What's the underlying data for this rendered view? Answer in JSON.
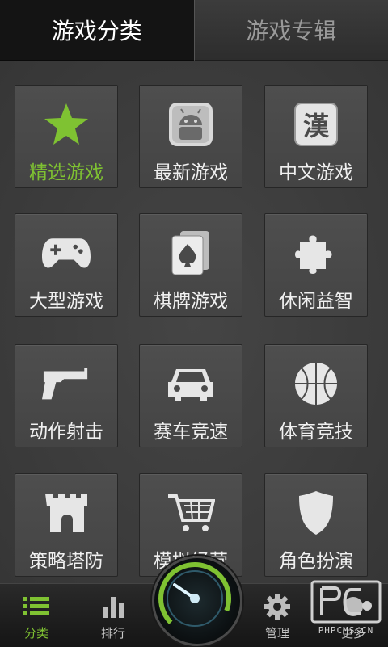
{
  "tabs": [
    {
      "label": "游戏分类",
      "active": true
    },
    {
      "label": "游戏专辑",
      "active": false
    }
  ],
  "categories": [
    {
      "label": "精选游戏",
      "icon": "star-icon",
      "selected": true
    },
    {
      "label": "最新游戏",
      "icon": "android-icon",
      "selected": false
    },
    {
      "label": "中文游戏",
      "icon": "chinese-character-icon",
      "glyph": "漢",
      "selected": false
    },
    {
      "label": "大型游戏",
      "icon": "gamepad-icon",
      "selected": false
    },
    {
      "label": "棋牌游戏",
      "icon": "playing-cards-icon",
      "selected": false
    },
    {
      "label": "休闲益智",
      "icon": "puzzle-piece-icon",
      "selected": false
    },
    {
      "label": "动作射击",
      "icon": "pistol-icon",
      "selected": false
    },
    {
      "label": "赛车竞速",
      "icon": "car-icon",
      "selected": false
    },
    {
      "label": "体育竞技",
      "icon": "basketball-icon",
      "selected": false
    },
    {
      "label": "策略塔防",
      "icon": "castle-tower-icon",
      "selected": false
    },
    {
      "label": "模拟经营",
      "icon": "shopping-cart-icon",
      "selected": false
    },
    {
      "label": "角色扮演",
      "icon": "shield-icon",
      "selected": false
    }
  ],
  "bottom_nav": [
    {
      "label": "分类",
      "icon": "list-icon",
      "active": true
    },
    {
      "label": "排行",
      "icon": "bar-chart-icon",
      "active": false
    },
    {
      "label": "",
      "icon": "speedometer-icon",
      "active": false
    },
    {
      "label": "管理",
      "icon": "gear-icon",
      "active": false
    },
    {
      "label": "更多",
      "icon": "more-icon",
      "active": false
    }
  ],
  "watermark": {
    "text": "PHPCMS.CN"
  },
  "colors": {
    "accent": "#7fc232",
    "tile": "#4a4a4a",
    "background": "#3a3a3a"
  }
}
